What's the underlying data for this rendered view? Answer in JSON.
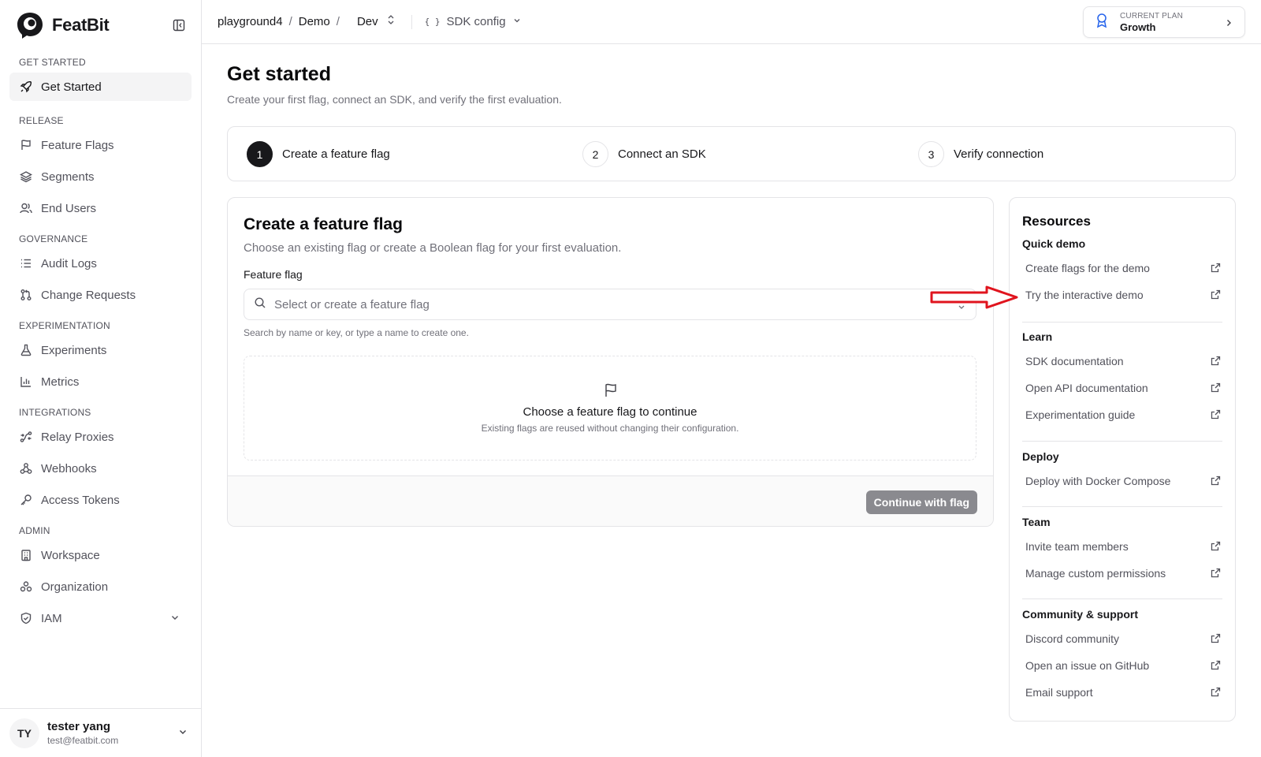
{
  "brand": {
    "name": "FeatBit"
  },
  "sidebar": {
    "sections": [
      {
        "title": "GET STARTED",
        "items": [
          {
            "label": "Get Started",
            "icon": "rocket-icon",
            "active": true
          }
        ]
      },
      {
        "title": "RELEASE",
        "items": [
          {
            "label": "Feature Flags",
            "icon": "flag-icon"
          },
          {
            "label": "Segments",
            "icon": "layers-icon"
          },
          {
            "label": "End Users",
            "icon": "users-icon"
          }
        ]
      },
      {
        "title": "GOVERNANCE",
        "items": [
          {
            "label": "Audit Logs",
            "icon": "list-icon"
          },
          {
            "label": "Change Requests",
            "icon": "git-pull-request-icon"
          }
        ]
      },
      {
        "title": "EXPERIMENTATION",
        "items": [
          {
            "label": "Experiments",
            "icon": "flask-icon"
          },
          {
            "label": "Metrics",
            "icon": "bar-chart-icon"
          }
        ]
      },
      {
        "title": "INTEGRATIONS",
        "items": [
          {
            "label": "Relay Proxies",
            "icon": "relay-icon"
          },
          {
            "label": "Webhooks",
            "icon": "webhook-icon"
          },
          {
            "label": "Access Tokens",
            "icon": "key-icon"
          }
        ]
      },
      {
        "title": "ADMIN",
        "items": [
          {
            "label": "Workspace",
            "icon": "building-icon"
          },
          {
            "label": "Organization",
            "icon": "organization-icon"
          },
          {
            "label": "IAM",
            "icon": "shield-icon"
          }
        ]
      }
    ]
  },
  "user": {
    "initials": "TY",
    "name": "tester yang",
    "email": "test@featbit.com"
  },
  "topbar": {
    "crumb_project": "playground4",
    "crumb_env_group": "Demo",
    "crumb_env": "Dev",
    "sdk_config": "SDK config",
    "plan_label": "CURRENT PLAN",
    "plan_value": "Growth"
  },
  "page": {
    "title": "Get started",
    "subtitle": "Create your first flag, connect an SDK, and verify the first evaluation."
  },
  "steps": [
    {
      "num": "1",
      "label": "Create a feature flag",
      "active": true
    },
    {
      "num": "2",
      "label": "Connect an SDK"
    },
    {
      "num": "3",
      "label": "Verify connection"
    }
  ],
  "create_card": {
    "title": "Create a feature flag",
    "subtitle": "Choose an existing flag or create a Boolean flag for your first evaluation.",
    "field_label": "Feature flag",
    "placeholder": "Select or create a feature flag",
    "help": "Search by name or key, or type a name to create one.",
    "empty_title": "Choose a feature flag to continue",
    "empty_sub": "Existing flags are reused without changing their configuration.",
    "continue_label": "Continue with flag"
  },
  "resources": {
    "title": "Resources",
    "groups": [
      {
        "heading": "Quick demo",
        "links": [
          "Create flags for the demo",
          "Try the interactive demo"
        ]
      },
      {
        "heading": "Learn",
        "links": [
          "SDK documentation",
          "Open API documentation",
          "Experimentation guide"
        ]
      },
      {
        "heading": "Deploy",
        "links": [
          "Deploy with Docker Compose"
        ]
      },
      {
        "heading": "Team",
        "links": [
          "Invite team members",
          "Manage custom permissions"
        ]
      },
      {
        "heading": "Community & support",
        "links": [
          "Discord community",
          "Open an issue on GitHub",
          "Email support"
        ]
      }
    ]
  },
  "colors": {
    "annotation_arrow": "#e0141e",
    "active_step": "#18181b",
    "disabled_button": "#8a8a8f"
  }
}
